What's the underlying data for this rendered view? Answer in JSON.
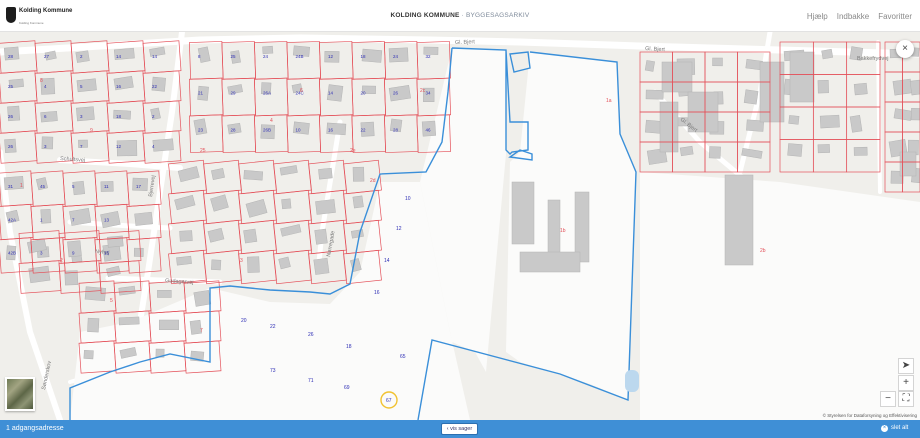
{
  "header": {
    "logo_name": "Kolding Kommune",
    "logo_sub": "Kolding Kommune",
    "title_main": "KOLDING KOMMUNE",
    "title_sep": " · ",
    "title_sub": "BYGGESAGSARKIV",
    "nav": [
      "Hjælp",
      "Indbakke",
      "Favoritter"
    ]
  },
  "map": {
    "street_labels": [
      "Schultsvej",
      "Gl. Bjert",
      "Gl. Bjert",
      "Gl. Bjert",
      "Bakkefrydvej",
      "Gudagervej",
      "Nørregade",
      "Bjerrevej",
      "Nyhøj",
      "Sønderskov"
    ],
    "house_numbers": [
      "28",
      "25",
      "26",
      "26",
      "27",
      "4",
      "6",
      "3",
      "2",
      "5",
      "3",
      "7",
      "14",
      "16",
      "18",
      "12",
      "14",
      "22",
      "2",
      "4",
      "8",
      "21",
      "23",
      "25",
      "29",
      "28",
      "24",
      "26A",
      "26B",
      "24B",
      "24C",
      "10",
      "12",
      "14",
      "16",
      "18",
      "20",
      "22",
      "24",
      "26",
      "28",
      "32",
      "34",
      "46",
      "31",
      "42A",
      "42B",
      "45",
      "1",
      "3",
      "5",
      "7",
      "9",
      "11",
      "13",
      "15",
      "17"
    ],
    "site_numbers": [
      "10",
      "12",
      "14",
      "16",
      "20",
      "22",
      "26",
      "18",
      "65",
      "73",
      "71",
      "69",
      "67"
    ],
    "cadastral_labels": [
      "8",
      "9",
      "1",
      "2",
      "5",
      "7",
      "3",
      "4",
      "6",
      "25",
      "2e",
      "2d",
      "2c",
      "1a",
      "1b",
      "2b"
    ]
  },
  "controls": {
    "close": "×",
    "locate": "➤",
    "zoom_in": "+",
    "zoom_out": "−",
    "extent": "⛶"
  },
  "attribution": "© Styrelsen for Dataforsyning og Effektivisering",
  "bottom": {
    "address_count": "1 adgangsadresse",
    "show_cases": "vis sager",
    "delete_all": "slet alt",
    "delete_icon": "×"
  },
  "colors": {
    "parcel_line": "#e4515a",
    "selection_line": "#3a8fd9",
    "building": "#c9c9c9",
    "road": "#ffffff",
    "background": "#f0efeb",
    "bar": "#3f8fd6"
  }
}
